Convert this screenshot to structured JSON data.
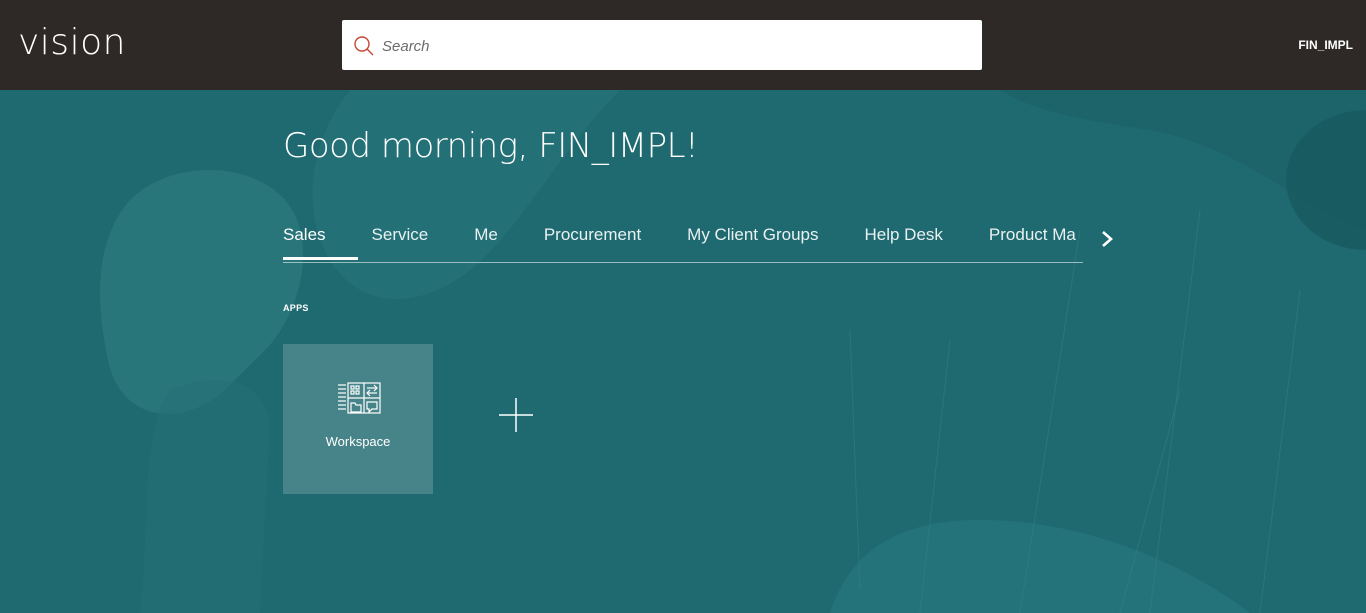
{
  "header": {
    "logo": "vision",
    "search": {
      "placeholder": "Search",
      "value": ""
    },
    "user": "FIN_IMPL"
  },
  "main": {
    "greeting": "Good morning, FIN_IMPL!",
    "tabs": [
      {
        "label": "Sales",
        "active": true
      },
      {
        "label": "Service"
      },
      {
        "label": "Me"
      },
      {
        "label": "Procurement"
      },
      {
        "label": "My Client Groups"
      },
      {
        "label": "Help Desk"
      },
      {
        "label": "Product Ma"
      }
    ],
    "apps_label": "APPS",
    "apps": [
      {
        "label": "Workspace",
        "icon": "workspace-icon"
      }
    ]
  },
  "colors": {
    "topbar": "#2e2926",
    "background": "#1f6a70",
    "search_icon": "#c74634"
  }
}
